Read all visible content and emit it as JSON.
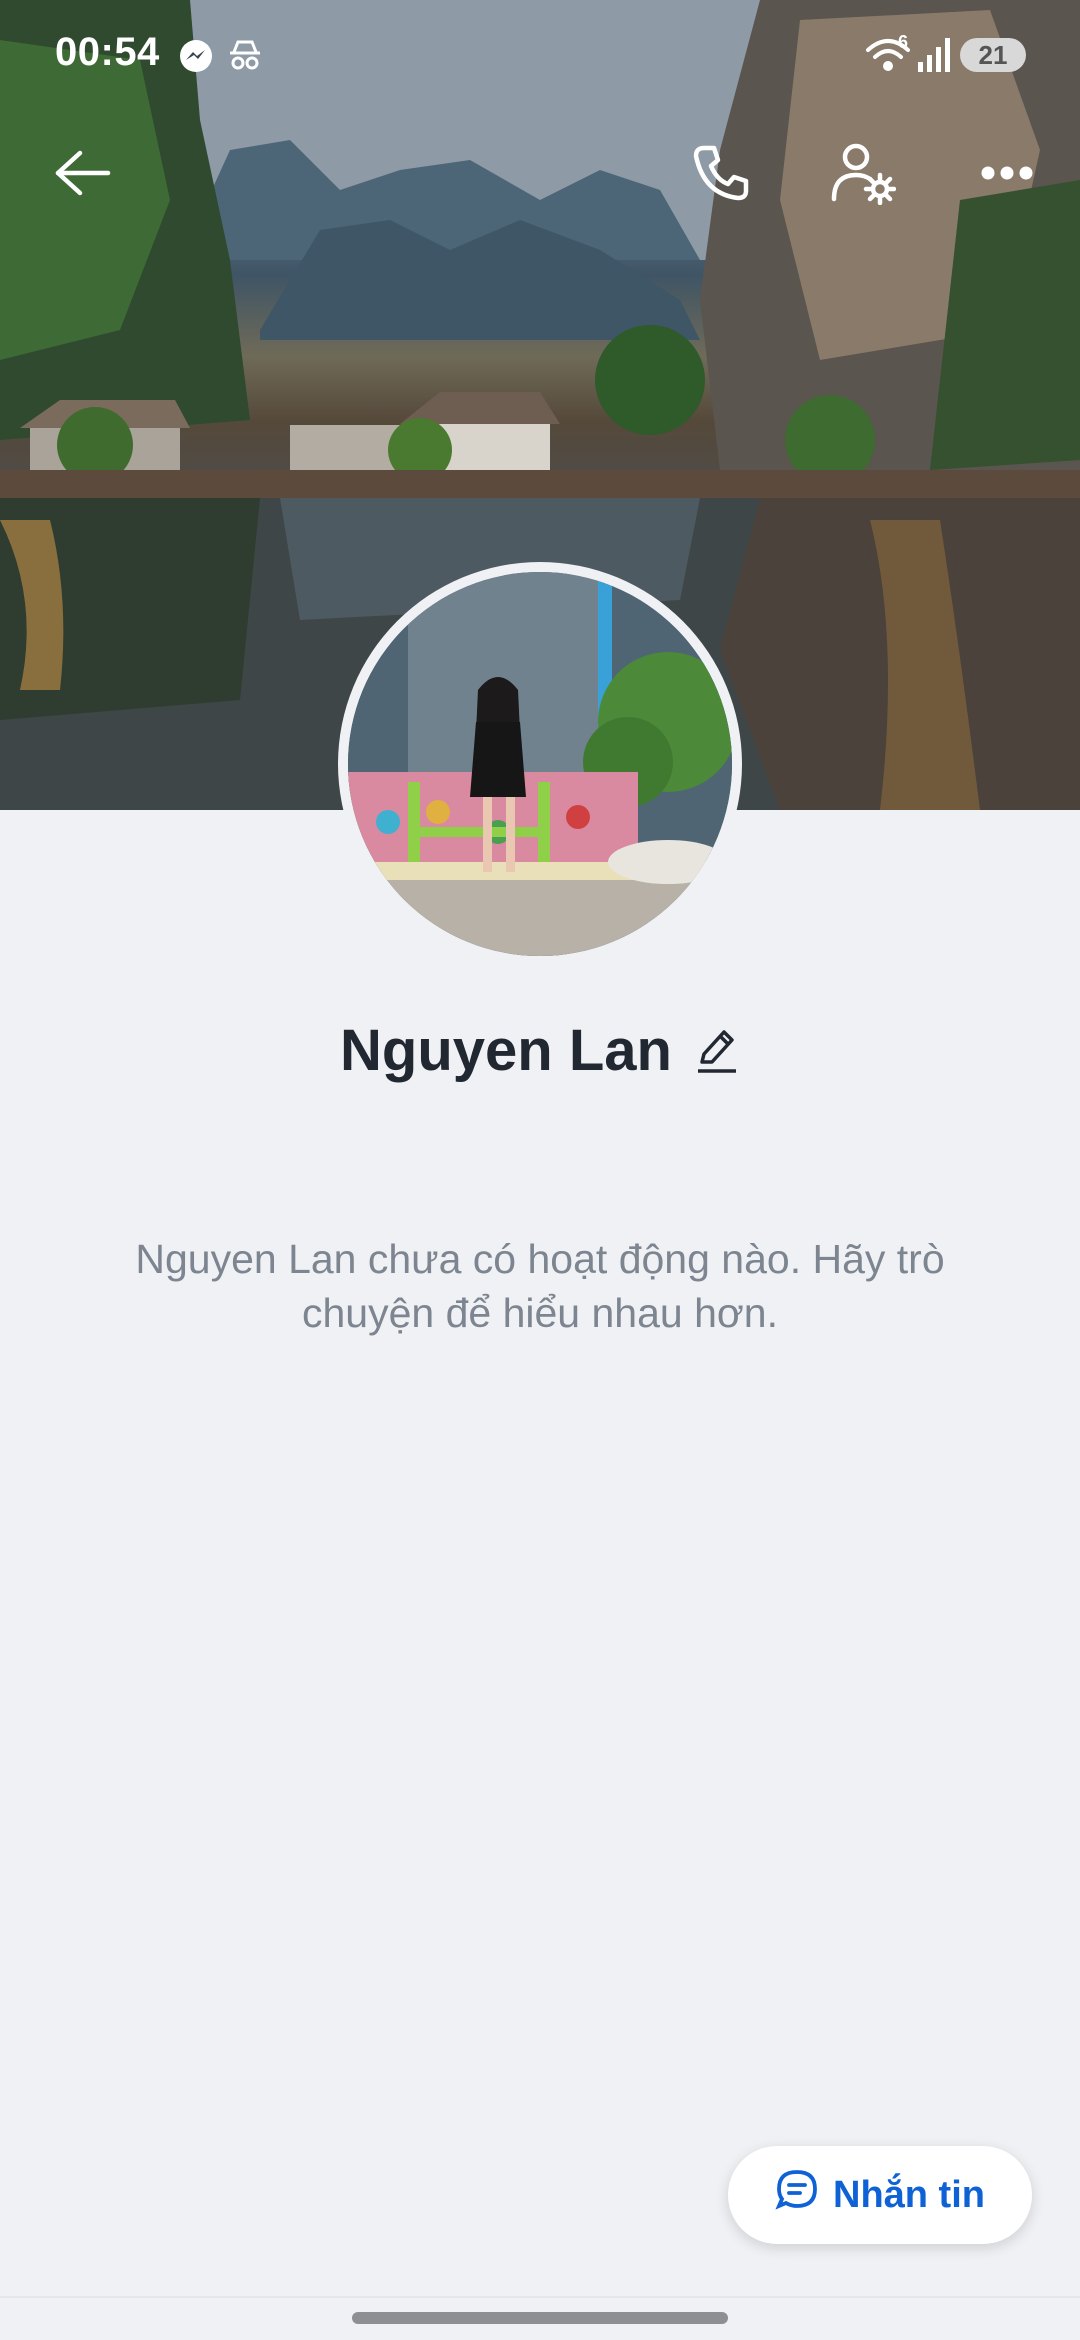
{
  "status_bar": {
    "time": "00:54",
    "notification_icons": [
      "messenger-icon",
      "incognito-icon"
    ],
    "wifi_badge": "6",
    "battery_level": "21"
  },
  "top_bar": {
    "icons": [
      "back-arrow-icon",
      "phone-icon",
      "user-settings-icon",
      "more-icon"
    ]
  },
  "profile": {
    "name": "Nguyen Lan",
    "empty_activity_text": "Nguyen Lan chưa có hoạt động nào. Hãy trò chuyện để hiểu nhau hơn."
  },
  "actions": {
    "message_button_label": "Nhắn tin"
  },
  "colors": {
    "background": "#f0f1f5",
    "accent": "#0f62d6",
    "name_text": "#222831",
    "muted_text": "#7d8590"
  }
}
